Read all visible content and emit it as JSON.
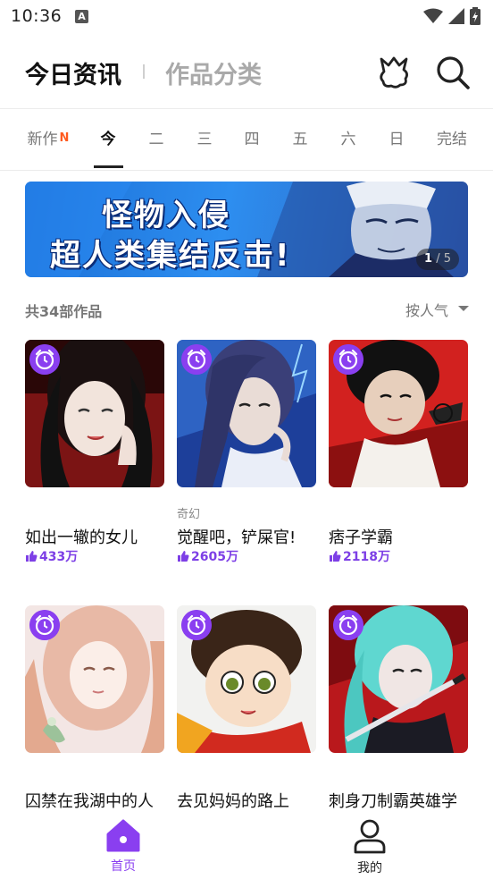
{
  "status": {
    "time": "10:36",
    "notification_letter": "A"
  },
  "header": {
    "title": "今日资讯",
    "title_secondary": "作品分类"
  },
  "tabs": [
    {
      "label": "新作",
      "badge": "N"
    },
    {
      "label": "今"
    },
    {
      "label": "二"
    },
    {
      "label": "三"
    },
    {
      "label": "四"
    },
    {
      "label": "五"
    },
    {
      "label": "六"
    },
    {
      "label": "日"
    },
    {
      "label": "完结"
    }
  ],
  "active_tab": "今",
  "banner": {
    "line1": "怪物入侵",
    "line2": "超人类集结反击!",
    "page_current": "1",
    "page_total": "/ 5"
  },
  "list": {
    "count_text": "共34部作品",
    "sort_label": "按人气"
  },
  "cards": [
    {
      "title": "如出一辙的女儿",
      "likes": "433万",
      "genre": ""
    },
    {
      "title": "觉醒吧，铲屎官!",
      "likes": "2605万",
      "genre": "奇幻"
    },
    {
      "title": "痞子学霸",
      "likes": "2118万",
      "genre": ""
    },
    {
      "title": "囚禁在我湖中的人",
      "likes": "",
      "genre": ""
    },
    {
      "title": "去见妈妈的路上",
      "likes": "",
      "genre": ""
    },
    {
      "title": "刺身刀制霸英雄学",
      "likes": "",
      "genre": ""
    }
  ],
  "bottom_nav": {
    "home_label": "首页",
    "me_label": "我的"
  },
  "colors": {
    "accent": "#7d3fe6",
    "new_badge": "#ff5b1f",
    "text_dark": "#111111",
    "text_muted": "#777777"
  },
  "icons": {
    "header": [
      "crown-badge-icon",
      "search-icon"
    ],
    "card": [
      "alarm-clock-icon",
      "thumbs-up-icon"
    ],
    "nav": [
      "home-icon",
      "user-icon"
    ]
  }
}
